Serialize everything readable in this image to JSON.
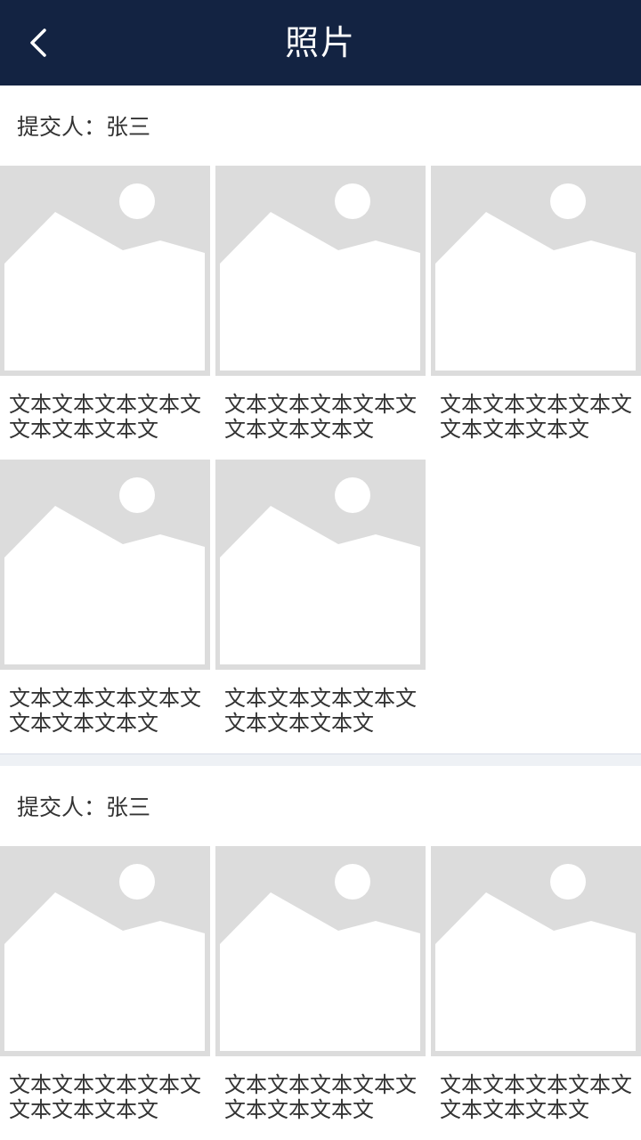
{
  "header": {
    "title": "照片",
    "back_icon": "chevron-left-icon"
  },
  "sections": [
    {
      "submitter": "提交人：张三",
      "photos": [
        {
          "caption": "文本文本文本文本文文本文本文本文"
        },
        {
          "caption": "文本文本文本文本文文本文本文本文"
        },
        {
          "caption": "文本文本文本文本文文本文本文本文"
        },
        {
          "caption": "文本文本文本文本文文本文本文本文"
        },
        {
          "caption": "文本文本文本文本文文本文本文本文"
        }
      ]
    },
    {
      "submitter": "提交人：张三",
      "photos": [
        {
          "caption": "文本文本文本文本文文本文本文本文"
        },
        {
          "caption": "文本文本文本文本文文本文本文本文"
        },
        {
          "caption": "文本文本文本文本文文本文本文本文"
        }
      ]
    }
  ],
  "colors": {
    "header_bg": "#132342",
    "placeholder_bg": "#dcdcdc",
    "divider_bg": "#eef1f5"
  }
}
